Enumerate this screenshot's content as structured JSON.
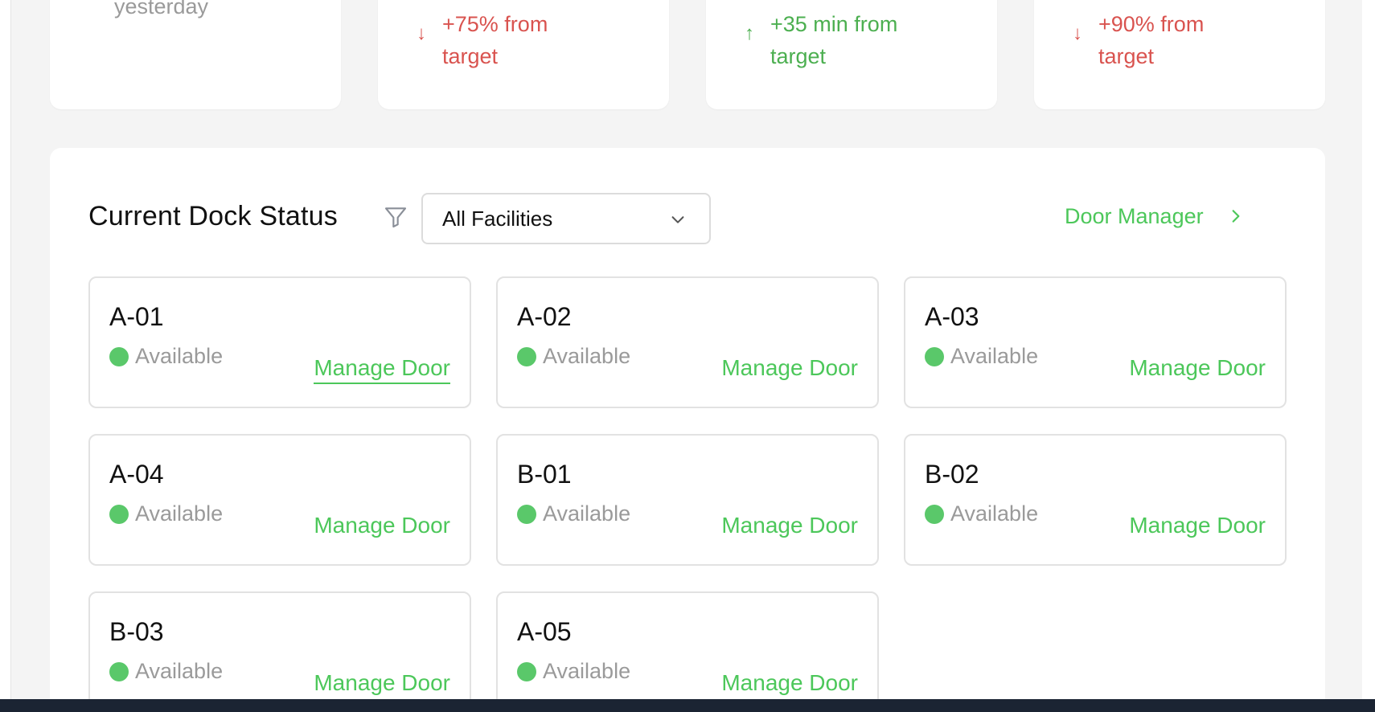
{
  "kpis": [
    {
      "arrow": "→",
      "change": "yesterday",
      "tone": "neutral"
    },
    {
      "arrow": "↓",
      "change": "+75% from target",
      "tone": "red"
    },
    {
      "arrow": "↑",
      "change": "+35 min from target",
      "tone": "green"
    },
    {
      "arrow": "↓",
      "change": "+90% from target",
      "tone": "red"
    }
  ],
  "dock": {
    "title": "Current Dock Status",
    "filter_icon": "filter-icon",
    "facility_select": "All Facilities",
    "door_manager_label": "Door Manager",
    "manage_label": "Manage Door",
    "doors": [
      {
        "name": "A-01",
        "status": "Available"
      },
      {
        "name": "A-02",
        "status": "Available"
      },
      {
        "name": "A-03",
        "status": "Available"
      },
      {
        "name": "A-04",
        "status": "Available"
      },
      {
        "name": "B-01",
        "status": "Available"
      },
      {
        "name": "B-02",
        "status": "Available"
      },
      {
        "name": "B-03",
        "status": "Available"
      },
      {
        "name": "A-05",
        "status": "Available"
      }
    ]
  },
  "colors": {
    "accent_green": "#4cc75a",
    "status_available": "#5ac86a",
    "negative": "#d9534f"
  }
}
